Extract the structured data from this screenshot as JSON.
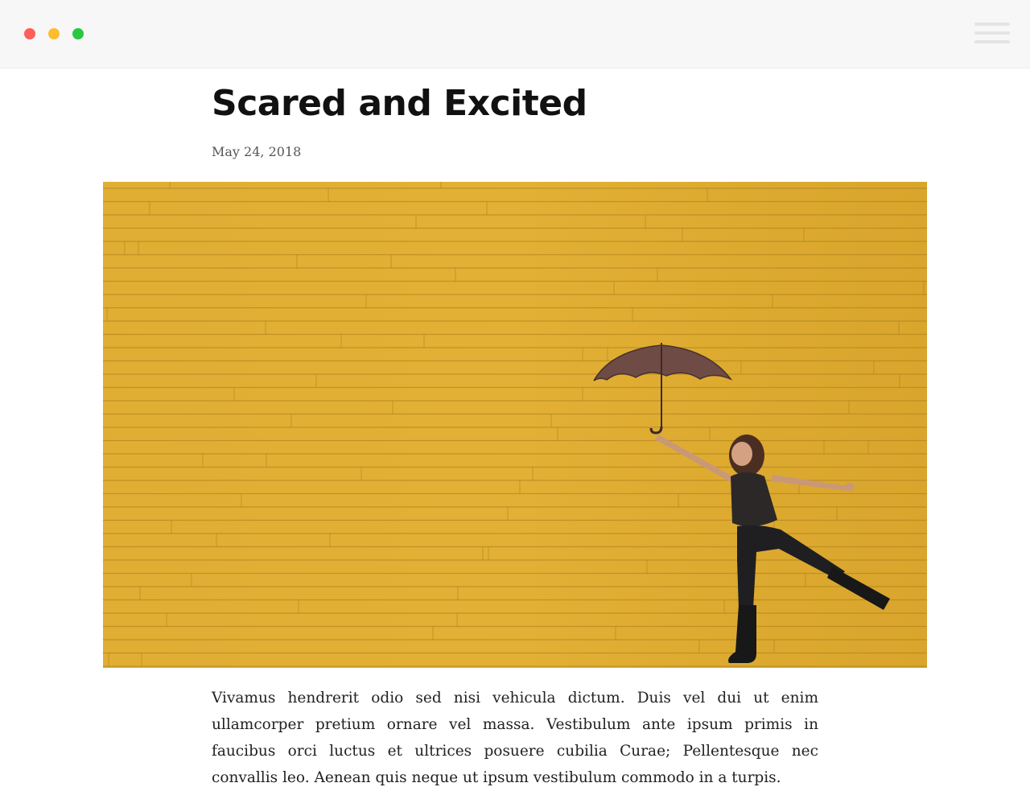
{
  "window": {
    "controls": [
      {
        "name": "close",
        "color": "#ff5f57"
      },
      {
        "name": "minimize",
        "color": "#febc2e"
      },
      {
        "name": "maximize",
        "color": "#28c840"
      }
    ],
    "menu_icon": "hamburger-menu-icon"
  },
  "post": {
    "title": "Scared and Excited",
    "date": "May 24, 2018",
    "image": {
      "subject": "woman jumping with umbrella in front of yellow wooden wall",
      "wall_color": "#deaa2e",
      "umbrella_color": "#6e4b45"
    },
    "body": "Vivamus hendrerit odio sed nisi vehicula dictum. Duis vel dui ut enim ullamcorper pretium ornare vel massa. Vestibulum ante ipsum primis in faucibus orci luctus et ultrices posuere cubilia Curae; Pellentesque nec convallis leo. Aenean quis neque ut ipsum vestibulum commodo in a turpis."
  }
}
